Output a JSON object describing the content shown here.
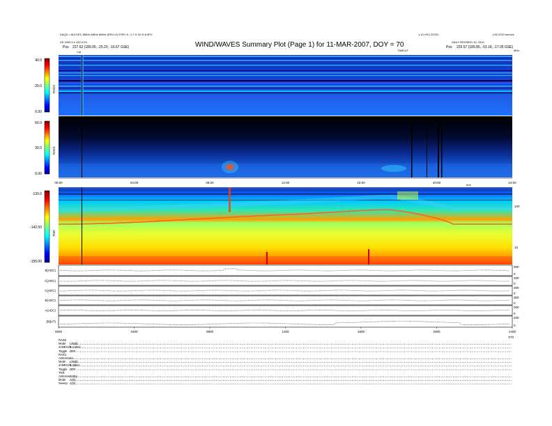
{
  "header": {
    "left_line1": "DAQ3 = 810 DEC 6MHz 6MHz 6MHz (RSV=0) STBY 8 - 0 7 6 16 VI 8 6PC",
    "left_line2": "AS 1000.0 s 100.0 D1",
    "left_pos_label": "Pos",
    "left_pos_value": "227.62 (189.05, -25.20, -16.67 GSE)",
    "title": "WIND/WAVES Summary Plot (Page 1) for 11-MAR-2007, DOY = 70",
    "right_line1": "1.10 VEX 2070C",
    "right_line2": "L35 0700 mm/s/s",
    "right_line3": "DAILY REVISED 10, 2010",
    "right_pos_label": "Pos",
    "right_pos_value": "226.57 (189.85, -53.18, -17.05 GSE)",
    "cal_label": "Cal",
    "time_ut_label": "TIME/UT",
    "mhz_label": "MHz",
    "khz_label": "kHz"
  },
  "panels": {
    "rad2": {
      "label": "RAD2",
      "ticks": [
        "40.0",
        "20.0",
        "0.00"
      ]
    },
    "rad1": {
      "label": "RAD1",
      "ticks": [
        "60.0",
        "30.0",
        "0.00"
      ]
    },
    "tnr": {
      "label": "TNR",
      "ticks": [
        "-130.0",
        "-142.50",
        "-155.00"
      ],
      "right_ticks": [
        "100",
        "10"
      ]
    }
  },
  "time_axis": {
    "ticks": [
      "00:00",
      "04:00",
      "08:00",
      "12:00",
      "16:00",
      "20:00",
      "24:00"
    ],
    "lower_ticks": [
      "0000",
      "0400",
      "0800",
      "1200",
      "1600",
      "2000",
      "2400"
    ],
    "end_label": "070"
  },
  "traces": [
    {
      "label": "B(ADC)",
      "scale": [
        "300",
        "0"
      ]
    },
    {
      "label": "C(ADC)",
      "scale": [
        "300",
        "0"
      ]
    },
    {
      "label": "C(ADC)",
      "scale": [
        "300",
        "0"
      ]
    },
    {
      "label": "B(ADC)",
      "scale": [
        "300",
        "0"
      ]
    },
    {
      "label": "A(ADC)",
      "scale": [
        "300",
        "0"
      ]
    },
    {
      "label": "|B|(nT)",
      "scale": [
        "200",
        "0"
      ]
    }
  ],
  "modes": [
    {
      "name": "RAD2",
      "value": ""
    },
    {
      "name": "Mode",
      "value": "LIN(8)"
    },
    {
      "name": "2/4MHz/P",
      "value": "3.4 MHz"
    },
    {
      "name": "Toggle",
      "value": "OFF"
    },
    {
      "name": "RAD1",
      "value": ""
    },
    {
      "name": "Antenna",
      "value": "Ex"
    },
    {
      "name": "Mode",
      "value": "LIN(8)"
    },
    {
      "name": "2/4MHz/P",
      "value": "3.4MHz"
    },
    {
      "name": "Toggle",
      "value": "OFF"
    },
    {
      "name": "TNR",
      "value": ""
    },
    {
      "name": "Antenna",
      "value": "Ex/Ey"
    },
    {
      "name": "Mode",
      "value": "A(S)"
    },
    {
      "name": "Sweep",
      "value": "A(S)"
    }
  ],
  "chart_data": [
    {
      "type": "heatmap",
      "title": "WIND/WAVES Summary Plot (Page 1) for 11-MAR-2007, DOY = 70",
      "panel": "RAD2",
      "ylabel": "RAD2",
      "ylim": [
        0,
        40
      ],
      "xlim": [
        "00:00",
        "24:00"
      ],
      "colormap": "jet"
    },
    {
      "type": "heatmap",
      "panel": "RAD1",
      "ylabel": "RAD1",
      "ylim": [
        0,
        60
      ],
      "xlim": [
        "00:00",
        "24:00"
      ],
      "colormap": "jet"
    },
    {
      "type": "heatmap",
      "panel": "TNR",
      "ylabel": "TNR",
      "ylim": [
        -155,
        -130
      ],
      "xlim": [
        "00:00",
        "24:00"
      ],
      "colormap": "jet"
    },
    {
      "type": "line",
      "panels": [
        "B(ADC)",
        "C(ADC)",
        "C(ADC)",
        "B(ADC)",
        "A(ADC)",
        "|B|(nT)"
      ],
      "xlim": [
        "0000",
        "2400"
      ]
    }
  ]
}
